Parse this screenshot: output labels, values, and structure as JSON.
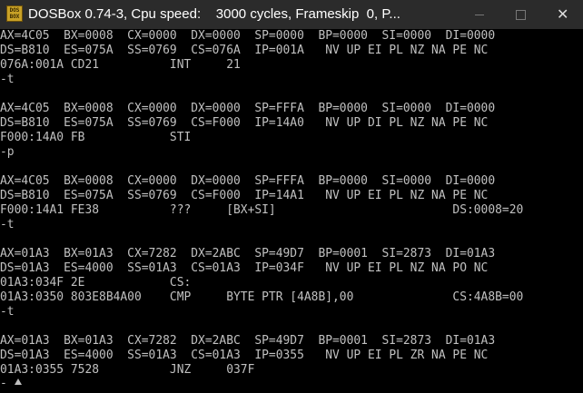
{
  "window": {
    "icon_label_top": "DOS",
    "icon_label_bottom": "BOX",
    "title": "DOSBox 0.74-3, Cpu speed:    3000 cycles, Frameskip  0, P..."
  },
  "terminal": {
    "lines": [
      "AX=4C05  BX=0008  CX=0000  DX=0000  SP=0000  BP=0000  SI=0000  DI=0000",
      "DS=B810  ES=075A  SS=0769  CS=076A  IP=001A   NV UP EI PL NZ NA PE NC",
      "076A:001A CD21          INT     21",
      "-t",
      "",
      "AX=4C05  BX=0008  CX=0000  DX=0000  SP=FFFA  BP=0000  SI=0000  DI=0000",
      "DS=B810  ES=075A  SS=0769  CS=F000  IP=14A0   NV UP DI PL NZ NA PE NC",
      "F000:14A0 FB            STI",
      "-p",
      "",
      "AX=4C05  BX=0008  CX=0000  DX=0000  SP=FFFA  BP=0000  SI=0000  DI=0000",
      "DS=B810  ES=075A  SS=0769  CS=F000  IP=14A1   NV UP EI PL NZ NA PE NC",
      "F000:14A1 FE38          ???     [BX+SI]                         DS:0008=20",
      "-t",
      "",
      "AX=01A3  BX=01A3  CX=7282  DX=2ABC  SP=49D7  BP=0001  SI=2873  DI=01A3",
      "DS=01A3  ES=4000  SS=01A3  CS=01A3  IP=034F   NV UP EI PL NZ NA PO NC",
      "01A3:034F 2E            CS:",
      "01A3:0350 803E8B4A00    CMP     BYTE PTR [4A8B],00              CS:4A8B=00",
      "-t",
      "",
      "AX=01A3  BX=01A3  CX=7282  DX=2ABC  SP=49D7  BP=0001  SI=2873  DI=01A3",
      "DS=01A3  ES=4000  SS=01A3  CS=01A3  IP=0355   NV UP EI PL ZR NA PE NC",
      "01A3:0355 7528          JNZ     037F"
    ],
    "prompt": "-"
  }
}
